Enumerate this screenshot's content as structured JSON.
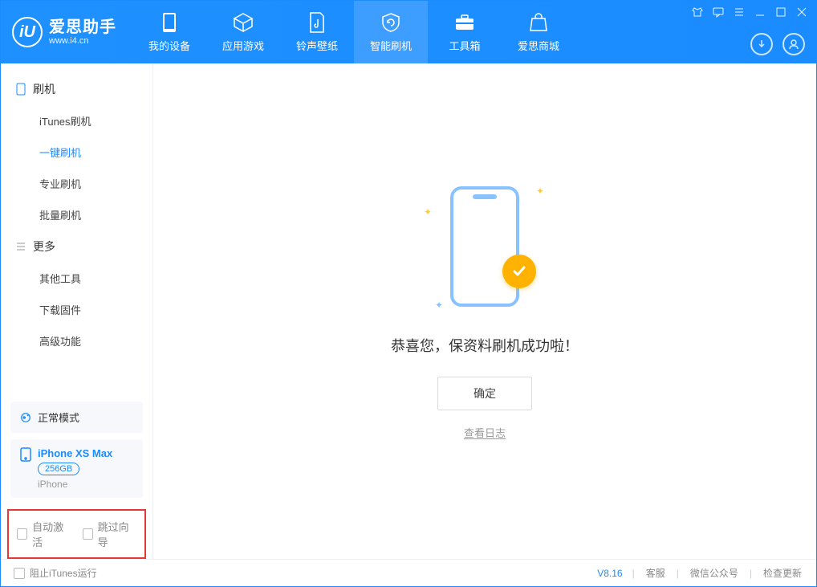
{
  "logo": {
    "glyph": "iU",
    "title": "爱思助手",
    "url": "www.i4.cn"
  },
  "nav": {
    "items": [
      {
        "label": "我的设备"
      },
      {
        "label": "应用游戏"
      },
      {
        "label": "铃声壁纸"
      },
      {
        "label": "智能刷机"
      },
      {
        "label": "工具箱"
      },
      {
        "label": "爱思商城"
      }
    ]
  },
  "sidebar": {
    "group1_title": "刷机",
    "group1_items": [
      {
        "label": "iTunes刷机"
      },
      {
        "label": "一键刷机"
      },
      {
        "label": "专业刷机"
      },
      {
        "label": "批量刷机"
      }
    ],
    "group2_title": "更多",
    "group2_items": [
      {
        "label": "其他工具"
      },
      {
        "label": "下载固件"
      },
      {
        "label": "高级功能"
      }
    ]
  },
  "mode": {
    "label": "正常模式"
  },
  "device": {
    "name": "iPhone XS Max",
    "storage": "256GB",
    "type": "iPhone"
  },
  "options": {
    "auto_activate": "自动激活",
    "skip_guide": "跳过向导"
  },
  "main": {
    "success_title": "恭喜您，保资料刷机成功啦！",
    "ok_button": "确定",
    "view_log": "查看日志"
  },
  "statusbar": {
    "block_itunes": "阻止iTunes运行",
    "version": "V8.16",
    "links": [
      "客服",
      "微信公众号",
      "检查更新"
    ]
  }
}
